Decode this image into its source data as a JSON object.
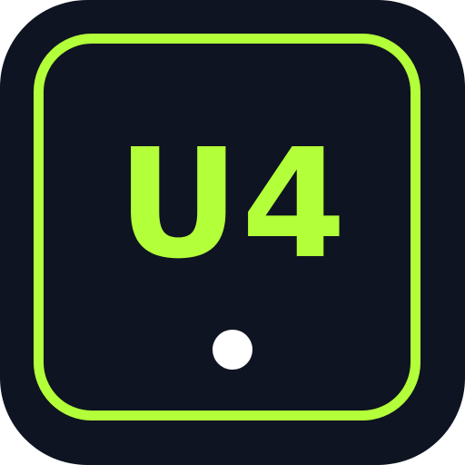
{
  "icon": {
    "label": "U4",
    "colors": {
      "background": "#0e1421",
      "accent": "#b3ff3a",
      "dot": "#ffffff"
    },
    "elements": [
      "rounded-square-frame",
      "indicator-dot"
    ]
  }
}
